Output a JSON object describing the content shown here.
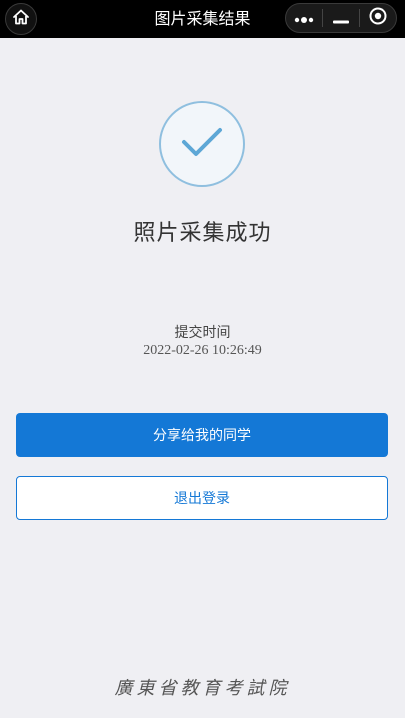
{
  "navbar": {
    "title": "图片采集结果",
    "home_icon": "home-icon",
    "menu_icon": "more-dots-icon",
    "minimize_icon": "minimize-icon",
    "close_icon": "target-circle-icon"
  },
  "result": {
    "icon": "check-circle-icon",
    "accent_color": "#8fbfdf",
    "title": "照片采集成功",
    "submit_label": "提交时间",
    "submit_time": "2022-02-26 10:26:49"
  },
  "actions": {
    "share_label": "分享给我的同学",
    "logout_label": "退出登录",
    "primary_color": "#1478d6"
  },
  "footer": {
    "org_name": "廣東省教育考試院"
  }
}
